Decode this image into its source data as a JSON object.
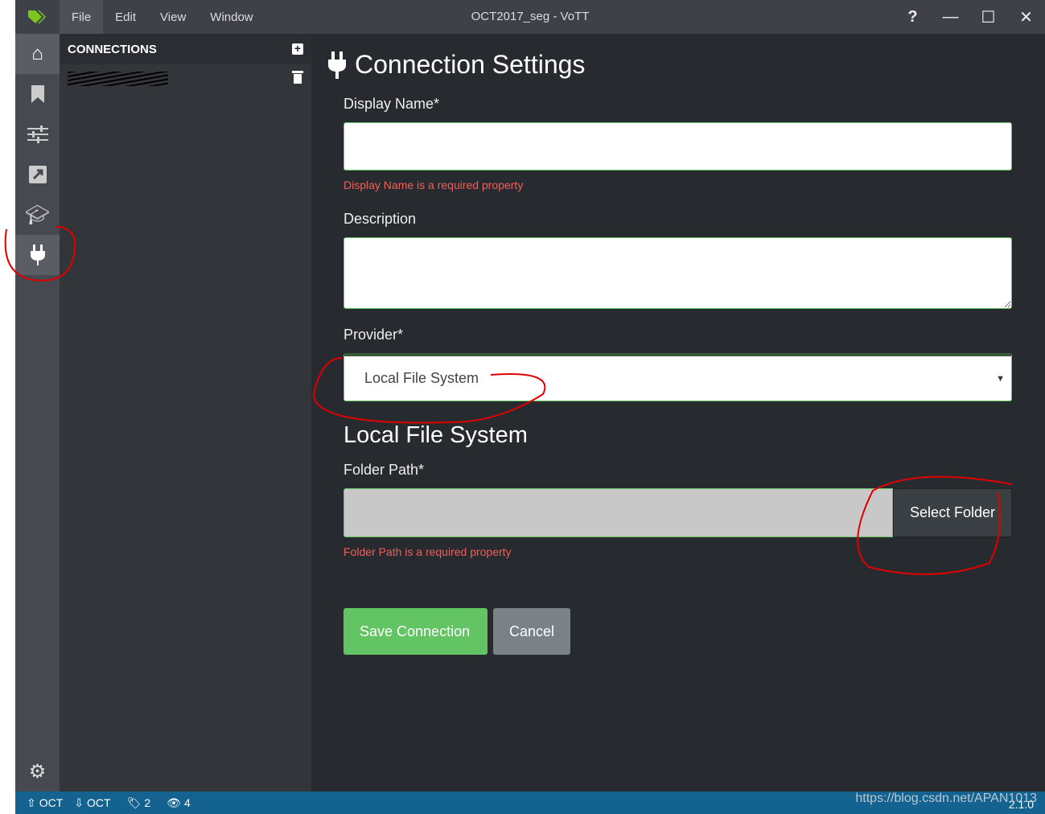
{
  "titlebar": {
    "menus": [
      "File",
      "Edit",
      "View",
      "Window"
    ],
    "title": "OCT2017_seg - VoTT",
    "help": "?",
    "minimize": "—",
    "maximize": "☐",
    "close": "✕"
  },
  "iconbar": {
    "items": [
      "home-icon",
      "bookmark-icon",
      "sliders-icon",
      "export-icon",
      "graduation-cap-icon",
      "plug-icon"
    ],
    "settings": "gear-icon"
  },
  "connections": {
    "header": "CONNECTIONS",
    "add": "+",
    "items": [
      {
        "label": "(redacted)"
      }
    ]
  },
  "form": {
    "title": "Connection Settings",
    "display_name_label": "Display Name*",
    "display_name_value": "",
    "display_name_error": "Display Name is a required property",
    "description_label": "Description",
    "description_value": "",
    "provider_label": "Provider*",
    "provider_value": "Local File System",
    "section_title": "Local File System",
    "folder_label": "Folder Path*",
    "folder_value": "",
    "select_folder": "Select Folder",
    "folder_error": "Folder Path is a required property",
    "save": "Save Connection",
    "cancel": "Cancel"
  },
  "statusbar": {
    "source": "OCT",
    "target": "OCT",
    "tags": "2",
    "visited": "4",
    "version": "2.1.0",
    "watermark": "https://blog.csdn.net/APAN1013"
  },
  "colors": {
    "accent": "#62c462",
    "error": "#ee5f5b",
    "status": "#14628f",
    "annotation": "#e00000"
  }
}
